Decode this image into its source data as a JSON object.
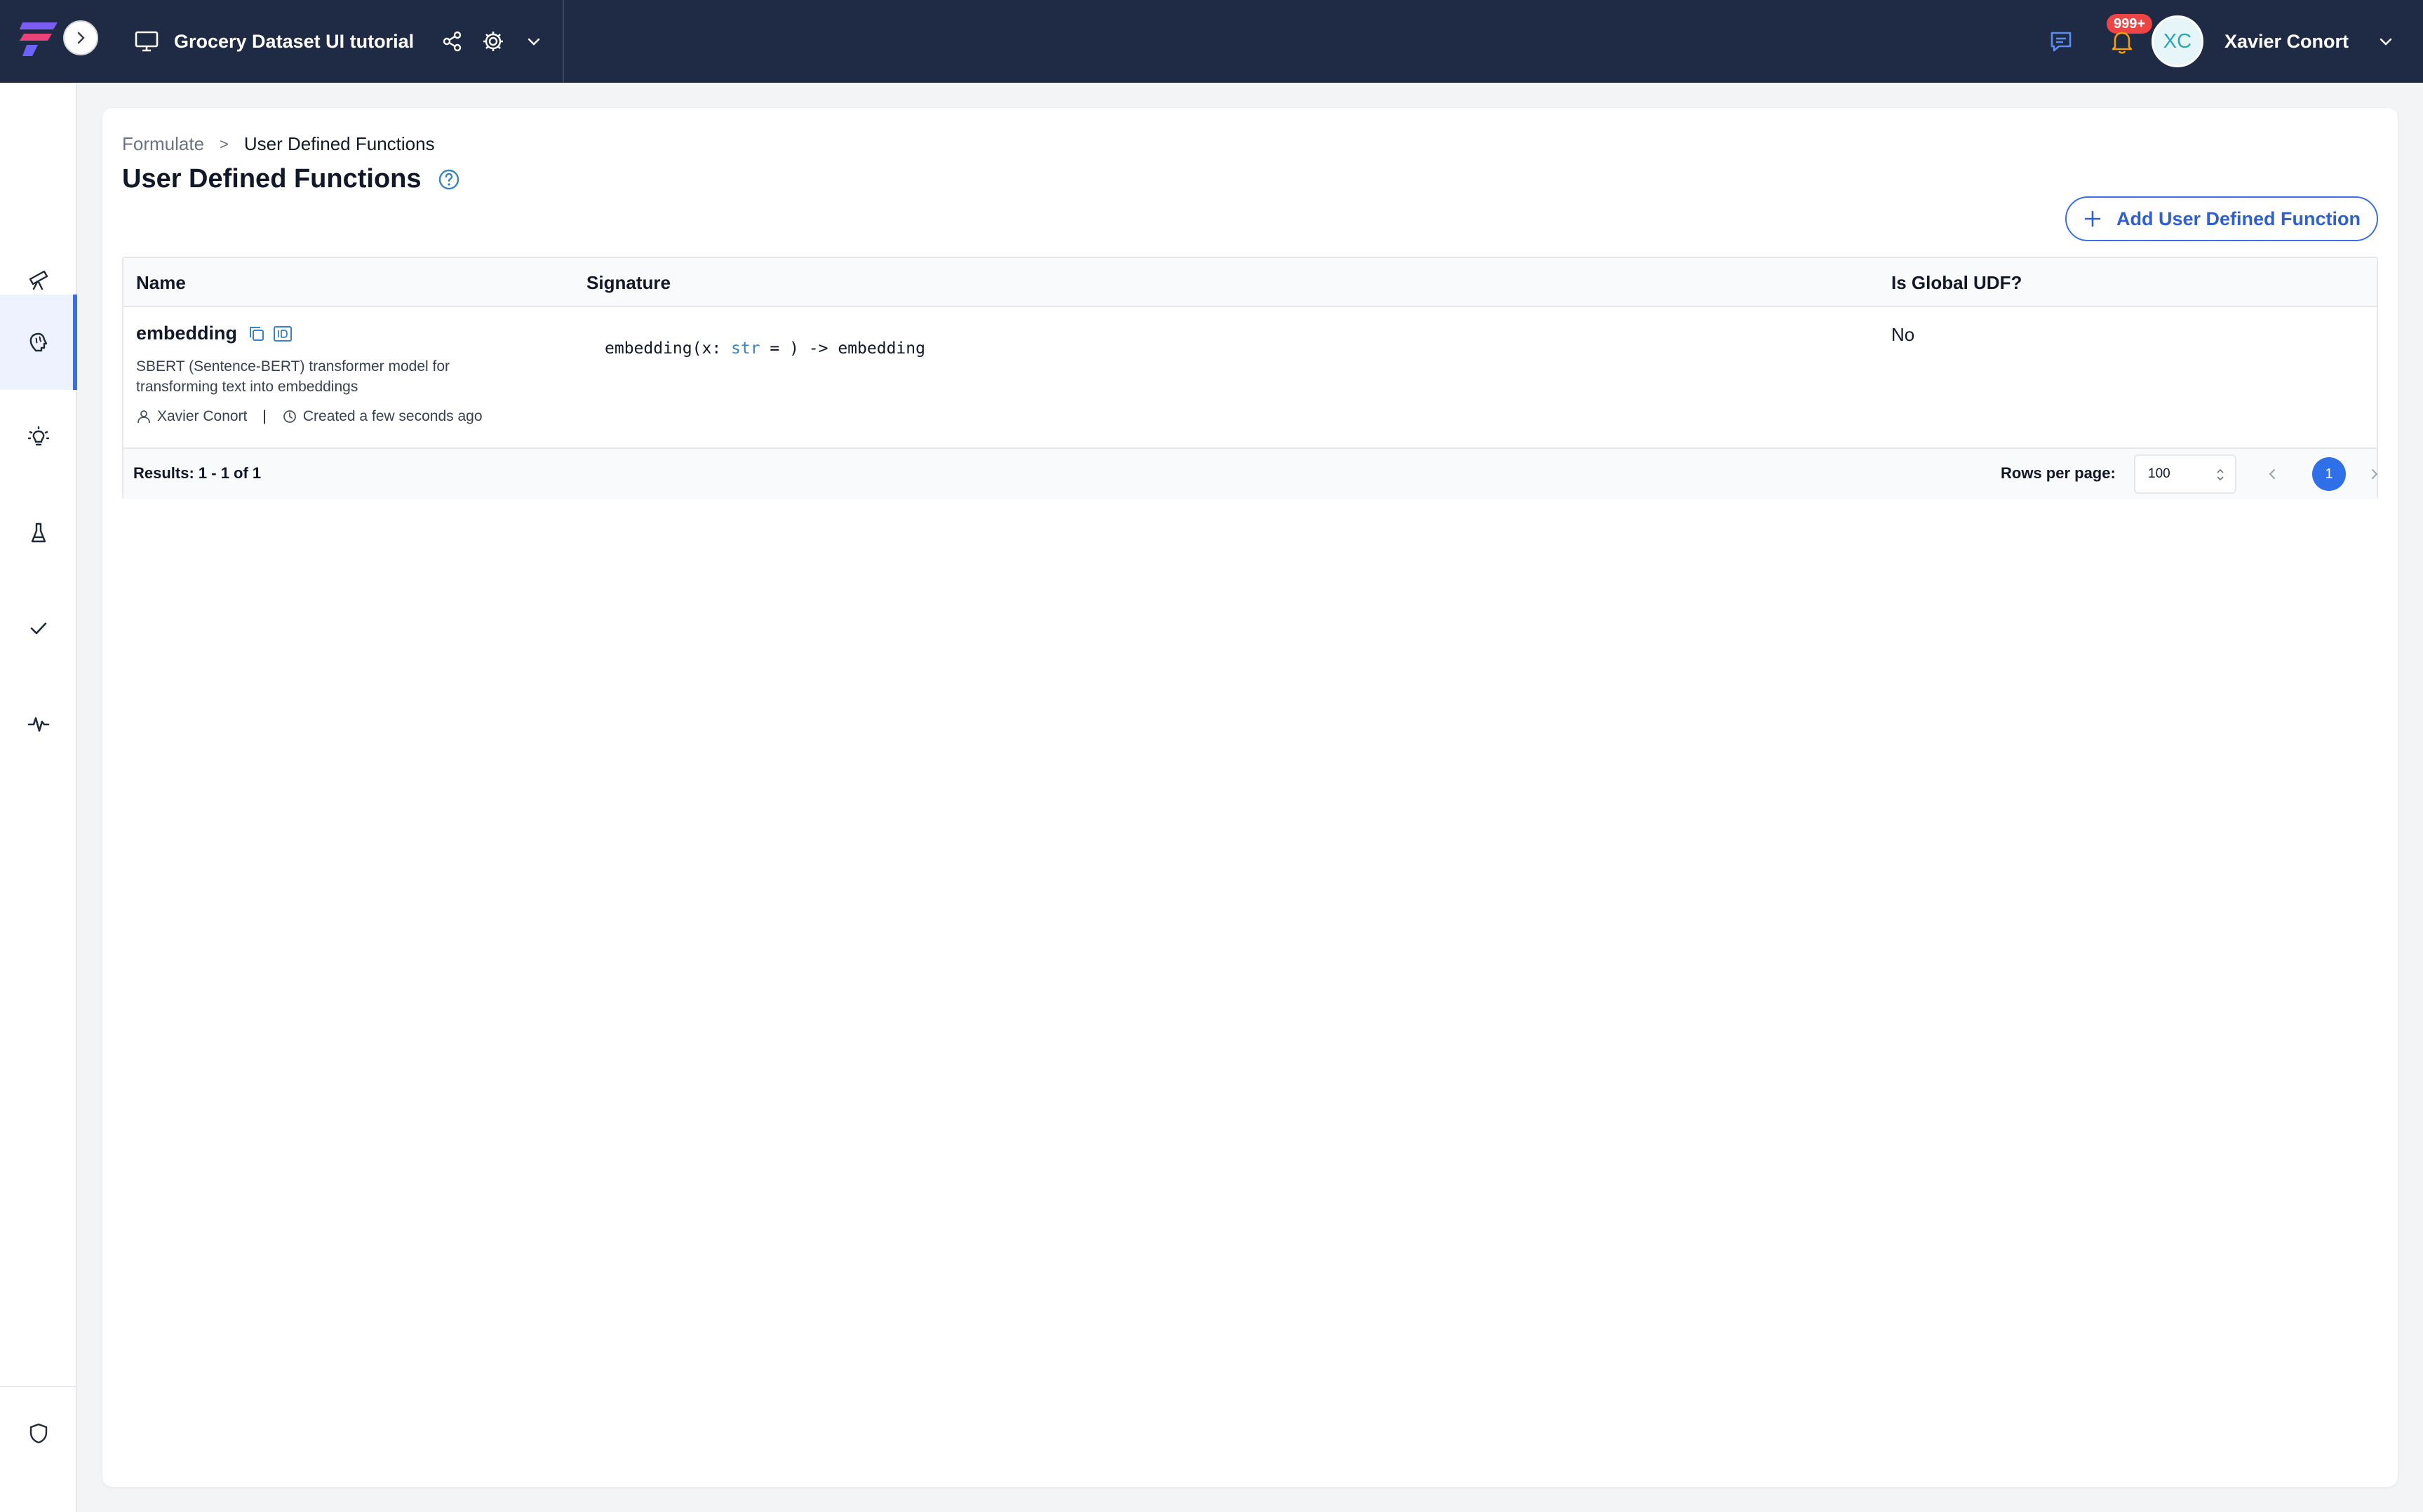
{
  "app": {
    "project_title": "Grocery Dataset UI tutorial",
    "notifications_badge": "999+",
    "user": {
      "initials": "XC",
      "name": "Xavier Conort"
    },
    "colors": {
      "topbar": "#1f2a44",
      "accent": "#3b6fe0",
      "badge": "#ef4444"
    }
  },
  "sidebar": {
    "items": [
      {
        "icon": "telescope-icon",
        "active": false
      },
      {
        "icon": "brain-icon",
        "active": true
      },
      {
        "icon": "lightbulb-icon",
        "active": false
      },
      {
        "icon": "flask-icon",
        "active": false
      },
      {
        "icon": "check-icon",
        "active": false
      },
      {
        "icon": "pulse-icon",
        "active": false
      }
    ],
    "bottom_items": [
      {
        "icon": "shield-icon"
      },
      {
        "icon": "user-search-icon"
      }
    ]
  },
  "page": {
    "breadcrumb": {
      "parent": "Formulate",
      "separator": ">",
      "current": "User Defined Functions"
    },
    "title": "User Defined Functions",
    "add_button_label": "Add User Defined Function"
  },
  "table": {
    "columns": {
      "name": "Name",
      "signature": "Signature",
      "global": "Is Global UDF?"
    },
    "rows": [
      {
        "name": "embedding",
        "description": "SBERT (Sentence-BERT) transformer model for transforming text into embeddings",
        "owner": "Xavier Conort",
        "created": "Created a few seconds ago",
        "signature": {
          "prefix": "embedding(x: ",
          "type": "str",
          "suffix": " = ) -> embedding"
        },
        "is_global": "No"
      }
    ],
    "footer": {
      "results": "Results: 1 - 1 of 1",
      "rows_per_page_label": "Rows per page:",
      "rows_per_page_value": "100",
      "current_page": "1"
    }
  }
}
